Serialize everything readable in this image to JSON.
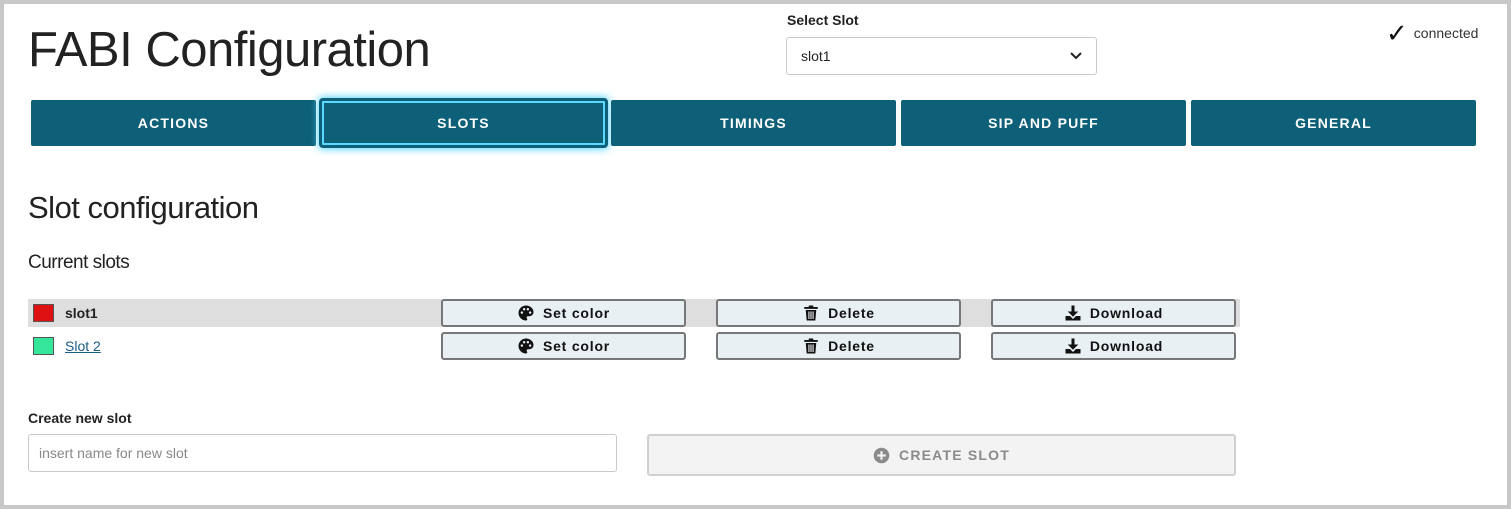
{
  "header": {
    "title": "FABI Configuration",
    "select_slot_label": "Select Slot",
    "selected_slot": "slot1",
    "status_icon": "check-icon",
    "status_text": "connected"
  },
  "tabs": [
    {
      "label": "ACTIONS",
      "active": false
    },
    {
      "label": "SLOTS",
      "active": true
    },
    {
      "label": "TIMINGS",
      "active": false
    },
    {
      "label": "SIP AND PUFF",
      "active": false
    },
    {
      "label": "GENERAL",
      "active": false
    }
  ],
  "main": {
    "title": "Slot configuration",
    "current_slots_label": "Current slots",
    "slots": [
      {
        "name": "slot1",
        "color": "#dd1111",
        "active": true,
        "set_color_label": "Set color",
        "delete_label": "Delete",
        "download_label": "Download"
      },
      {
        "name": "Slot 2",
        "color": "#33e699",
        "active": false,
        "set_color_label": "Set color",
        "delete_label": "Delete",
        "download_label": "Download"
      }
    ],
    "create": {
      "label": "Create new slot",
      "placeholder": "insert name for new slot",
      "button_label": "CREATE SLOT",
      "button_icon": "plus-circle-icon"
    }
  },
  "colors": {
    "accent": "#0e5f78",
    "active_glow": "#4fd3ff",
    "button_bg": "#e9f0f4",
    "link": "#1a5d86"
  }
}
